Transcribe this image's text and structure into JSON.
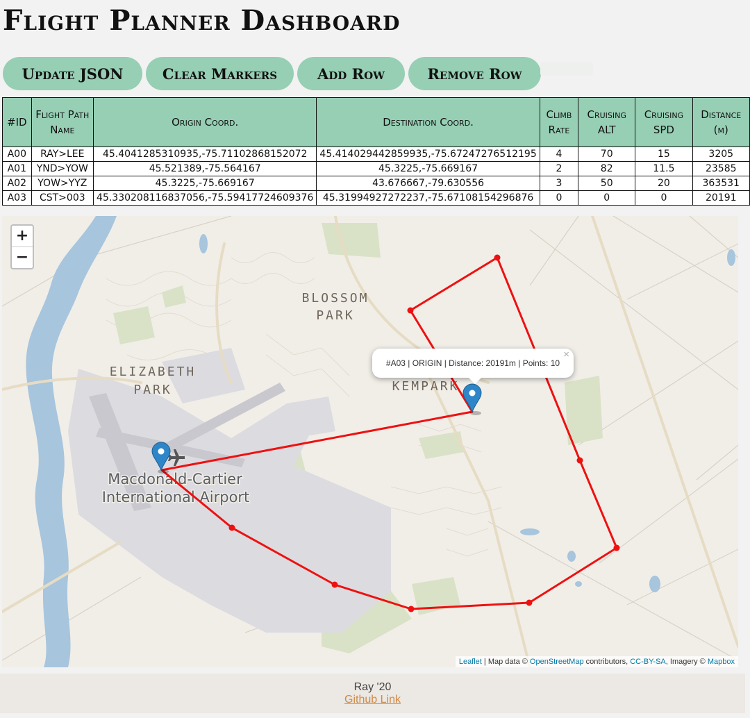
{
  "page": {
    "title": "Flight Planner Dashboard"
  },
  "toolbar": {
    "update_json": "Update JSON",
    "clear_markers": "Clear Markers",
    "add_row": "Add Row",
    "remove_row": "Remove Row"
  },
  "table": {
    "headers": [
      "#ID",
      "Flight Path Name",
      "Origin Coord.",
      "Destination Coord.",
      "Climb Rate",
      "Cruising ALT",
      "Cruising SPD",
      "Distance (m)"
    ],
    "rows": [
      [
        "A00",
        "RAY>LEE",
        "45.4041285310935,-75.71102868152072",
        "45.414029442859935,-75.67247276512195",
        "4",
        "70",
        "15",
        "3205"
      ],
      [
        "A01",
        "YND>YOW",
        "45.521389,-75.564167",
        "45.3225,-75.669167",
        "2",
        "82",
        "11.5",
        "23585"
      ],
      [
        "A02",
        "YOW>YYZ",
        "45.3225,-75.669167",
        "43.676667,-79.630556",
        "3",
        "50",
        "20",
        "363531"
      ],
      [
        "A03",
        "CST>003",
        "45.330208116837056,-75.59417724609376",
        "45.31994927272237,-75.67108154296876",
        "0",
        "0",
        "0",
        "20191"
      ]
    ]
  },
  "map": {
    "zoom_in": "+",
    "zoom_out": "−",
    "labels": {
      "blossom_1": "BLOSSOM",
      "blossom_2": "PARK",
      "elizabeth_1": "ELIZABETH",
      "elizabeth_2": "PARK",
      "kempark": "KEMPARK",
      "airport_1": "Macdonald-Cartier",
      "airport_2": "International Airport"
    },
    "popup_text": "#A03 | ORIGIN | Distance: 20191m | Points: 10",
    "popup_close": "×",
    "attribution": {
      "leaflet": "Leaflet",
      "sep1": " | Map data © ",
      "osm": "OpenStreetMap",
      "sep2": " contributors, ",
      "license": "CC-BY-SA",
      "sep3": ", Imagery © ",
      "mapbox": "Mapbox"
    },
    "colors": {
      "route": "#ee1111",
      "marker": "#2e86c8",
      "water": "#a7c5dd",
      "park": "#d9e2c6",
      "airport": "#dcdbe0"
    }
  },
  "footer": {
    "credit": "Ray '20",
    "link": "Github Link"
  }
}
